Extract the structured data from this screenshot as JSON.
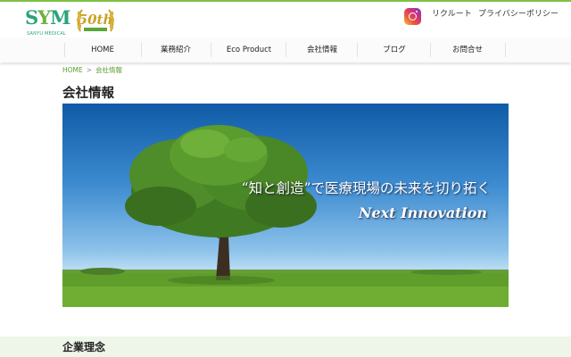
{
  "brand": {
    "logo_text_s": "S",
    "logo_text_v": "Y",
    "logo_text_m": "M",
    "logo_sub": "SANYU MEDICAL",
    "anniversary_text": "50th",
    "accent_color": "#7cc242"
  },
  "header": {
    "links": [
      {
        "label": "リクルート"
      },
      {
        "label": "プライバシーポリシー"
      }
    ],
    "social_icon": "instagram-icon"
  },
  "nav": {
    "items": [
      {
        "label": "HOME"
      },
      {
        "label": "業務紹介"
      },
      {
        "label": "Eco Product"
      },
      {
        "label": "会社情報"
      },
      {
        "label": "ブログ"
      },
      {
        "label": "お問合せ"
      }
    ]
  },
  "breadcrumb": {
    "home": "HOME",
    "separator": ">",
    "current": "会社情報"
  },
  "page": {
    "title": "会社情報"
  },
  "hero": {
    "catchphrase": "“知と創造”で医療現場の未来を切り拓く",
    "subtitle": "Next Innovation"
  },
  "sections": {
    "philosophy_title": "企業理念"
  }
}
